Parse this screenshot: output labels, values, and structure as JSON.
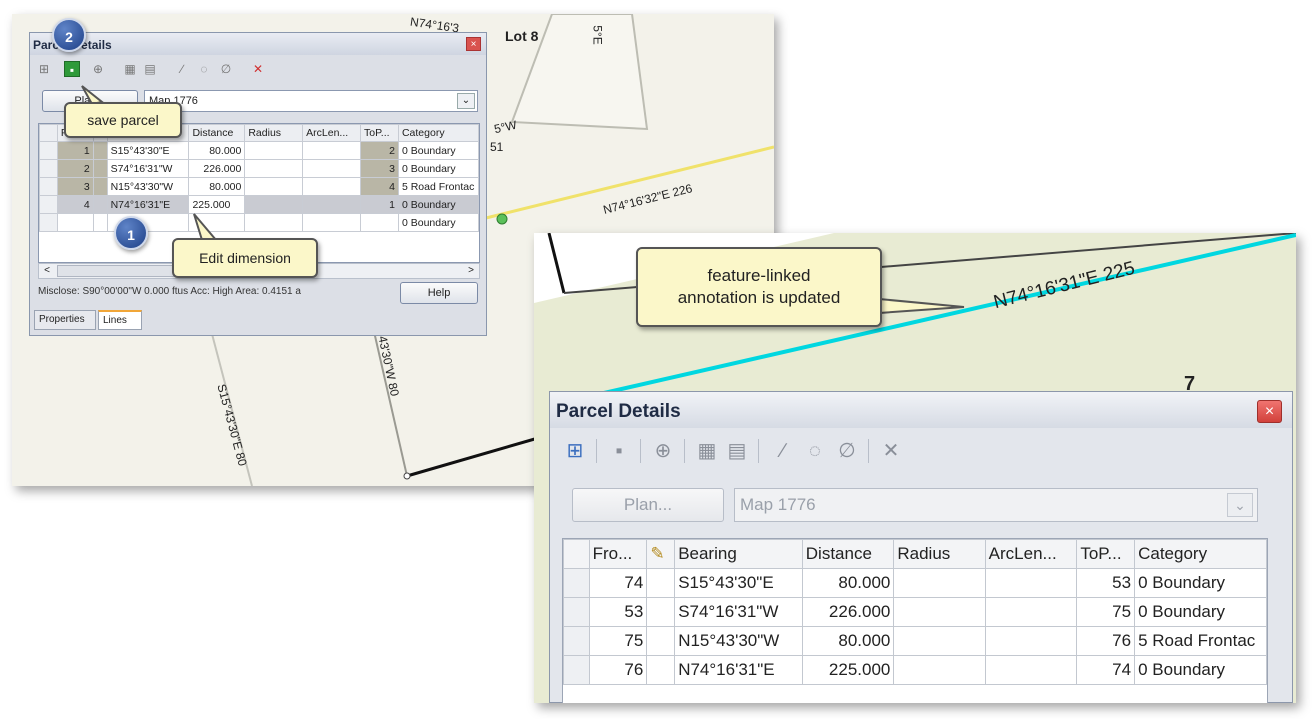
{
  "screenshot1": {
    "map_labels": {
      "lot": "Lot 8",
      "top": "N74°16'3",
      "top_right": "5°E",
      "partial_west": "5°W",
      "partial_51": "51",
      "road_label": "N74°16'32\"E 226",
      "left_vertical": "S15°43'30\"E 80",
      "right_vertical": "43'30\"W 80"
    },
    "window": {
      "title": "Parcel Details",
      "close": "×",
      "toolbar_icons": [
        "parcel-info-icon",
        "save-parcel-icon",
        "join-parcel-icon",
        "grid-icon",
        "grid-edit-icon",
        "line-tool-icon",
        "curve-tool-icon",
        "null-icon",
        "delete-arrow-icon"
      ],
      "plan_button": "Plan...",
      "map_value": "Map 1776",
      "dropdown_arrow": "⌄",
      "columns": [
        "",
        "Fr",
        "",
        "Bearing",
        "Distance",
        "Radius",
        "ArcLen...",
        "ToP...",
        "Category"
      ],
      "rows": [
        {
          "from": "1",
          "bearing": "S15°43'30\"E",
          "distance": "80.000",
          "to": "2",
          "category": "0 Boundary"
        },
        {
          "from": "2",
          "bearing": "S74°16'31\"W",
          "distance": "226.000",
          "to": "3",
          "category": "0 Boundary"
        },
        {
          "from": "3",
          "bearing": "N15°43'30\"W",
          "distance": "80.000",
          "to": "4",
          "category": "5 Road Frontac"
        },
        {
          "from": "4",
          "bearing": "N74°16'31\"E",
          "distance": "225.000",
          "to": "1",
          "category": "0 Boundary"
        },
        {
          "from": "",
          "bearing": "",
          "distance": "",
          "to": "",
          "category": "0 Boundary"
        }
      ],
      "scroll_left": "<",
      "scroll_right": ">",
      "status": "Misclose: S90°00'00\"W 0.000 ftus  Acc: High  Area: 0.4151 a",
      "help_button": "Help",
      "tabs": [
        "Properties",
        "Lines"
      ]
    },
    "badge_1": "1",
    "badge_2": "2",
    "callout_save": "save parcel",
    "callout_edit": "Edit dimension"
  },
  "screenshot2": {
    "annotation": "N74°16'31\"E 225",
    "number_7": "7",
    "callout_text": "feature-linked\nannotation is updated",
    "window": {
      "title": "Parcel Details",
      "close": "×",
      "toolbar_icons": [
        "parcel-info-icon",
        "save-parcel-icon",
        "join-parcel-icon",
        "grid-icon",
        "grid-edit-icon",
        "line-tool-icon",
        "curve-tool-icon",
        "null-icon",
        "delete-arrow-icon"
      ],
      "plan_button": "Plan...",
      "map_value": "Map 1776",
      "dropdown_arrow": "⌄",
      "columns": [
        "",
        "Fro...",
        "✎",
        "Bearing",
        "Distance",
        "Radius",
        "ArcLen...",
        "ToP...",
        "Category"
      ],
      "rows": [
        {
          "from": "74",
          "bearing": "S15°43'30\"E",
          "distance": "80.000",
          "to": "53",
          "category": "0 Boundary"
        },
        {
          "from": "53",
          "bearing": "S74°16'31\"W",
          "distance": "226.000",
          "to": "75",
          "category": "0 Boundary"
        },
        {
          "from": "75",
          "bearing": "N15°43'30\"W",
          "distance": "80.000",
          "to": "76",
          "category": "5 Road Frontac"
        },
        {
          "from": "76",
          "bearing": "N74°16'31\"E",
          "distance": "225.000",
          "to": "74",
          "category": "0 Boundary"
        }
      ]
    }
  }
}
